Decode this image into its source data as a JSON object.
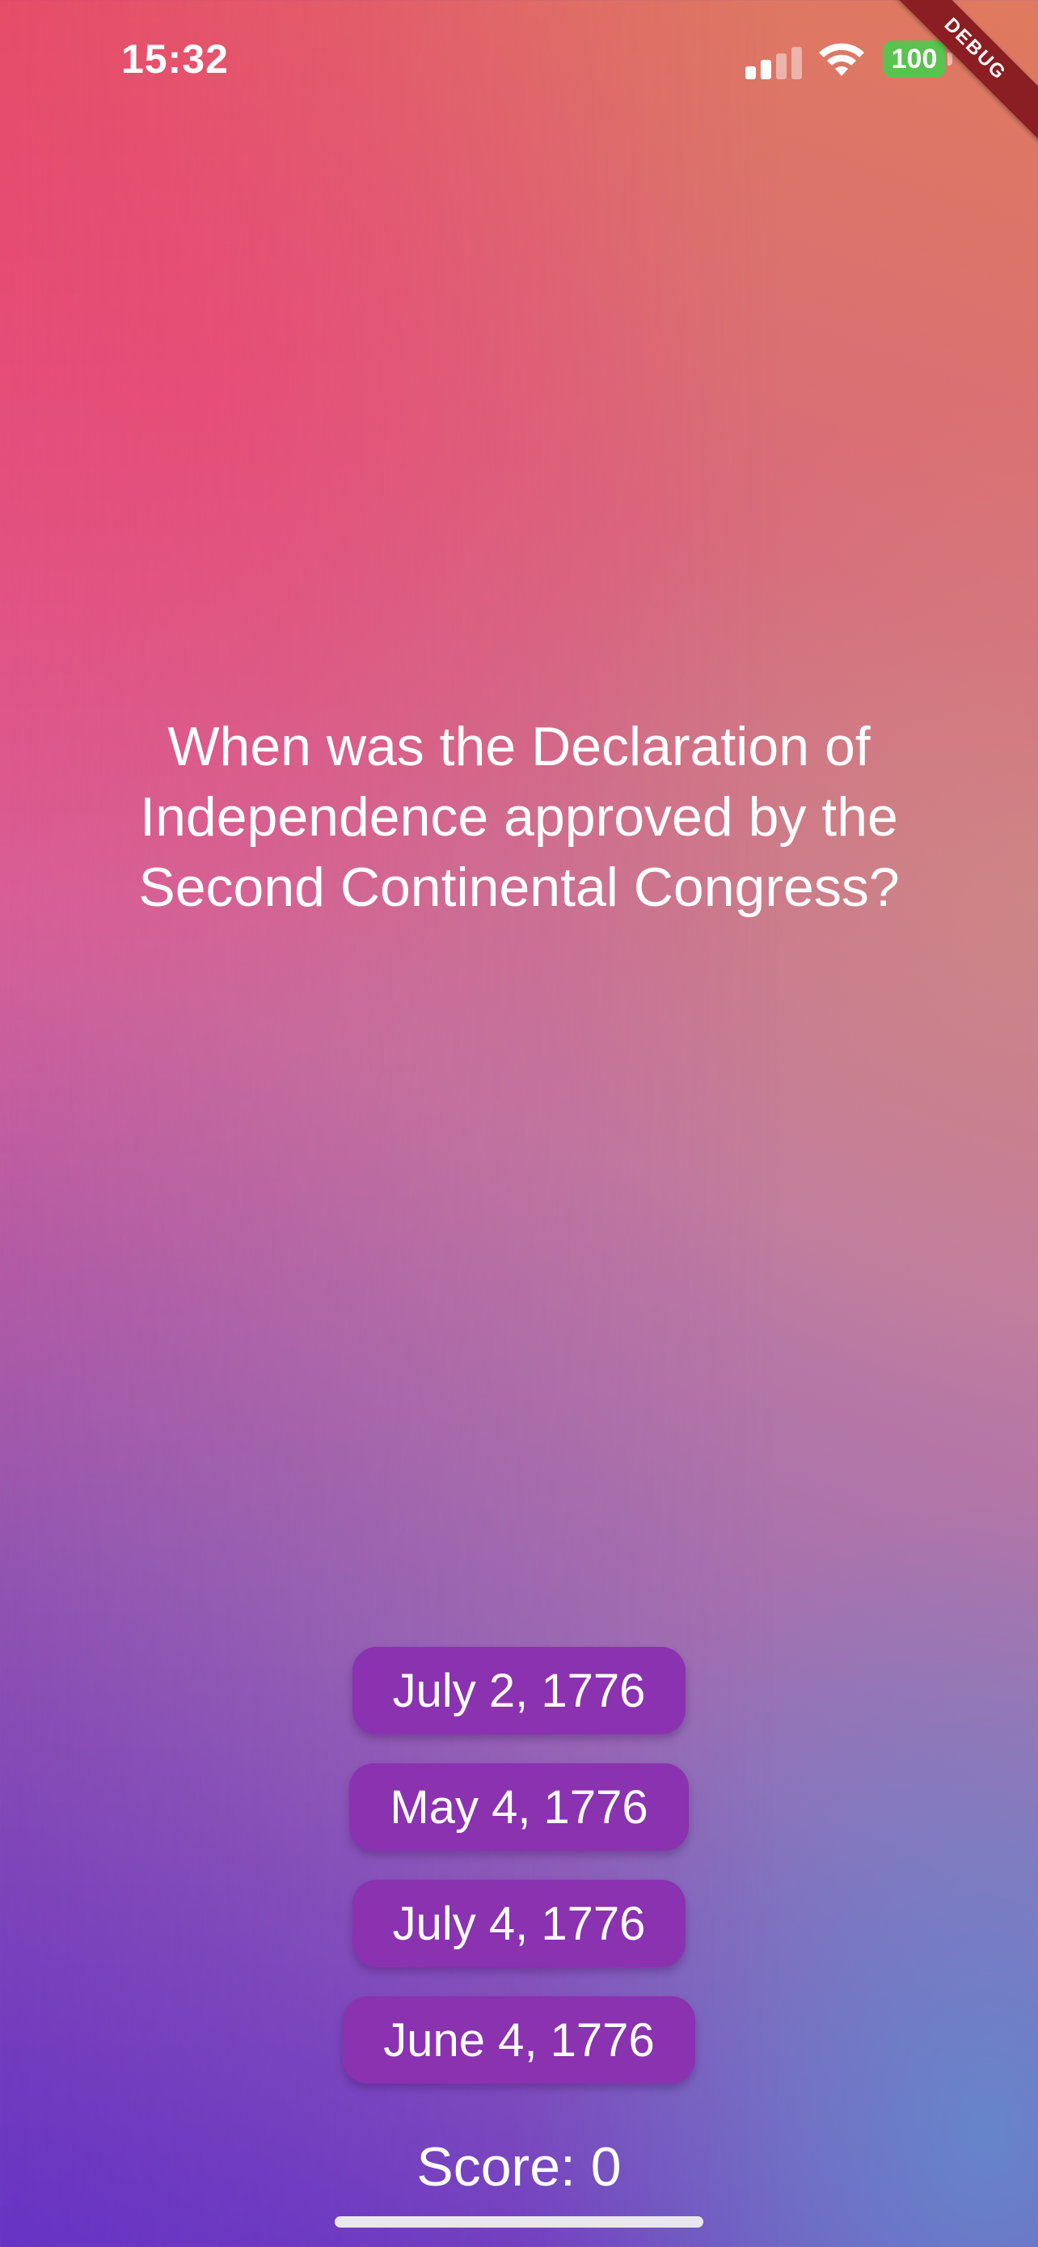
{
  "status_bar": {
    "time": "15:32",
    "battery": "100",
    "signal_icon": "cellular-signal-icon",
    "wifi_icon": "wifi-icon",
    "battery_color": "#5ac24f"
  },
  "debug_banner": {
    "label": "DEBUG",
    "color": "#8a1e22"
  },
  "quiz": {
    "question": "When was the Declaration of Independence approved by the Second Continental Congress?",
    "answers": [
      {
        "label": "July 2, 1776"
      },
      {
        "label": "May 4, 1776"
      },
      {
        "label": "July 4, 1776"
      },
      {
        "label": "June 4, 1776"
      }
    ],
    "button_color": "#8a32b0"
  },
  "score": {
    "text": "Score: 0"
  }
}
